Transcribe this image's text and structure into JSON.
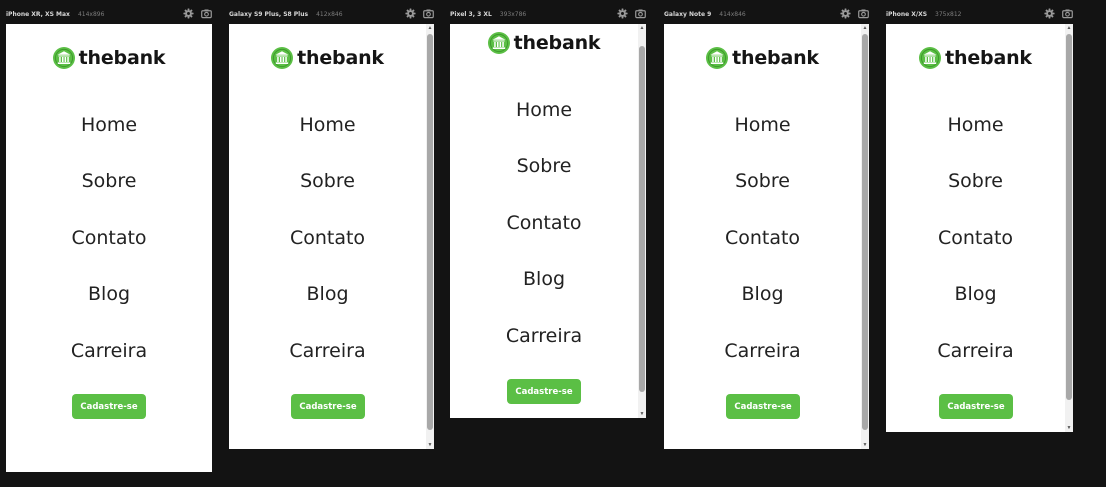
{
  "brand": {
    "name": "thebank",
    "icon": "bank-icon",
    "color": "#5bbf45"
  },
  "nav": [
    "Home",
    "Sobre",
    "Contato",
    "Blog",
    "Carreira"
  ],
  "cta_label": "Cadastre-se",
  "toolbar_icons": [
    "gear-icon",
    "camera-icon"
  ],
  "devices": [
    {
      "name": "iPhone XR, XS Max",
      "size": "414x896"
    },
    {
      "name": "Galaxy S9 Plus, S8 Plus",
      "size": "412x846"
    },
    {
      "name": "Pixel 3, 3 XL",
      "size": "393x786"
    },
    {
      "name": "Galaxy Note 9",
      "size": "414x846"
    },
    {
      "name": "iPhone X/XS",
      "size": "375x812"
    }
  ]
}
